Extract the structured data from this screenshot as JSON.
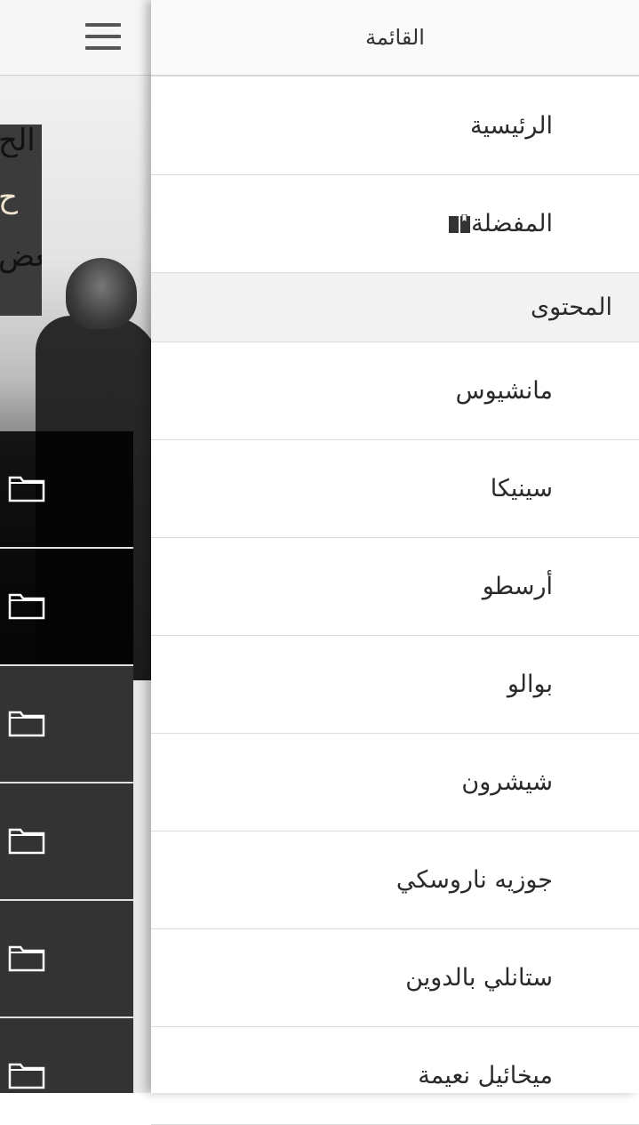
{
  "background_page": {
    "menu_icon": "hamburger-icon",
    "banner_quote_lines": [
      "الح",
      "ح",
      "بعض"
    ],
    "list_icon": "folder-icon",
    "list_item_count": 6
  },
  "drawer": {
    "title": "القائمة",
    "items": [
      {
        "label": "الرئيسية"
      },
      {
        "label": "المفضلة",
        "icon": "bookmark-icon"
      }
    ],
    "section_title": "المحتوى",
    "content_items": [
      {
        "label": "مانشيوس"
      },
      {
        "label": "سينيكا"
      },
      {
        "label": "أرسطو"
      },
      {
        "label": "بوالو"
      },
      {
        "label": "شيشرون"
      },
      {
        "label": "جوزيه ناروسكي"
      },
      {
        "label": "ستانلي بالدوين"
      },
      {
        "label": "ميخائيل نعيمة"
      }
    ]
  }
}
